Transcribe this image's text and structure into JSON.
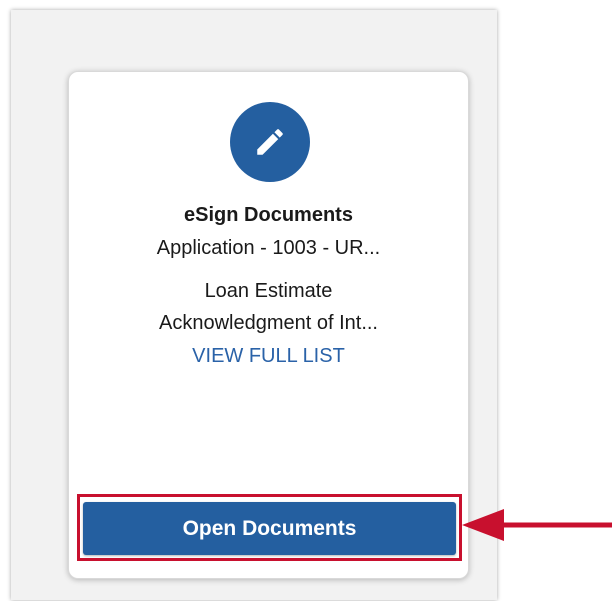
{
  "card": {
    "icon": "pencil-icon",
    "title": "eSign Documents",
    "subtitle": "Application - 1003 - UR...",
    "documents": [
      "Loan Estimate",
      "Acknowledgment of Int..."
    ],
    "view_full_list_label": "VIEW FULL LIST",
    "open_button_label": "Open Documents"
  },
  "annotation": {
    "highlight": "red-outline-box",
    "pointer": "arrow-left-icon"
  },
  "colors": {
    "brand_blue": "#245fa0",
    "link_blue": "#2a62a8",
    "highlight_red": "#c8102e",
    "panel_background": "#f2f2f2",
    "card_background": "#ffffff"
  }
}
